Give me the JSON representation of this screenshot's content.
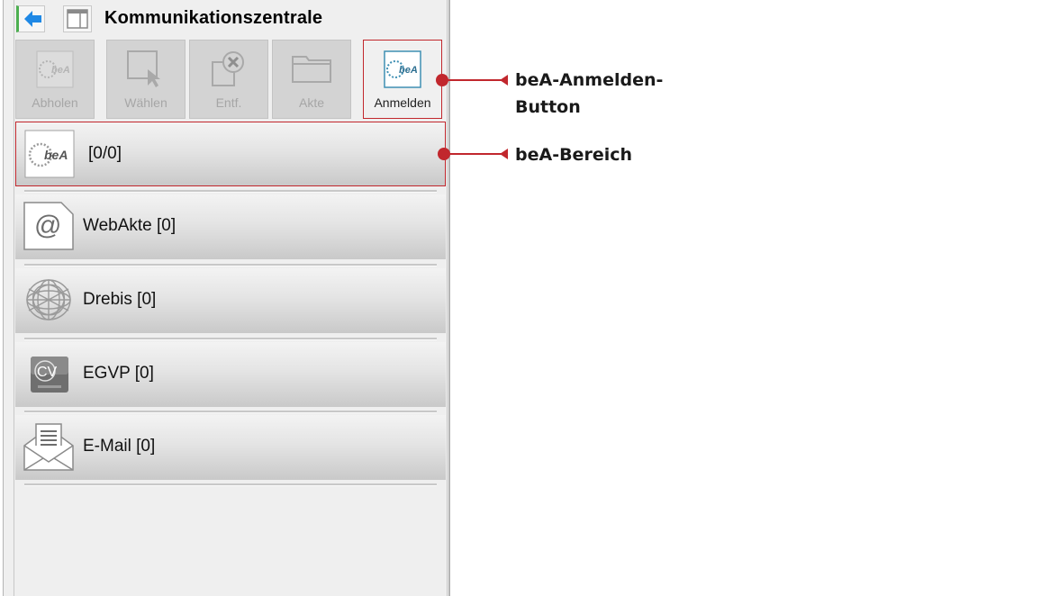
{
  "app": {
    "title": "Kommunikationszentrale"
  },
  "toolbar": {
    "buttons": [
      {
        "label": "Abholen",
        "icon": "bea-logo-icon",
        "enabled": false
      },
      {
        "label": "Wählen",
        "icon": "select-cursor-icon",
        "enabled": false
      },
      {
        "label": "Entf.",
        "icon": "delete-document-icon",
        "enabled": false
      },
      {
        "label": "Akte",
        "icon": "folder-icon",
        "enabled": false
      },
      {
        "label": "Anmelden",
        "icon": "bea-logo-icon",
        "enabled": true
      }
    ]
  },
  "list": {
    "items": [
      {
        "label": "[0/0]",
        "icon": "bea-logo-icon",
        "selected": true
      },
      {
        "label": "WebAkte [0]",
        "icon": "at-sign-icon",
        "selected": false
      },
      {
        "label": "Drebis [0]",
        "icon": "globe-mesh-icon",
        "selected": false
      },
      {
        "label": "EGVP [0]",
        "icon": "cv-logo-icon",
        "selected": false
      },
      {
        "label": "E-Mail [0]",
        "icon": "envelope-letter-icon",
        "selected": false
      }
    ]
  },
  "callouts": {
    "anmelden_line1": "beA-Anmelden-",
    "anmelden_line2": "Button",
    "bereich": "beA-Bereich"
  },
  "colors": {
    "highlight": "#c1272d",
    "back_arrow": "#1e88e5",
    "accent_green": "#4caf50"
  }
}
